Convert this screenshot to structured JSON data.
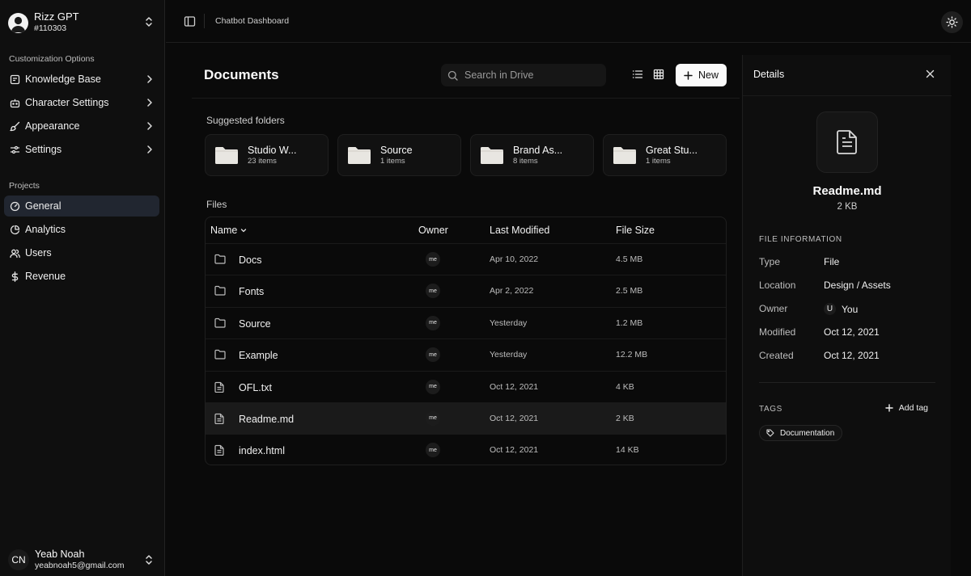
{
  "team": {
    "name": "Rizz GPT",
    "id": "#110303"
  },
  "sidebar": {
    "section_customization": "Customization Options",
    "customization_items": [
      {
        "label": "Knowledge Base",
        "icon": "book-icon"
      },
      {
        "label": "Character Settings",
        "icon": "bot-icon"
      },
      {
        "label": "Appearance",
        "icon": "brush-icon"
      },
      {
        "label": "Settings",
        "icon": "sliders-icon"
      }
    ],
    "section_projects": "Projects",
    "project_items": [
      {
        "label": "General",
        "icon": "gauge-icon",
        "active": true
      },
      {
        "label": "Analytics",
        "icon": "pie-chart-icon"
      },
      {
        "label": "Users",
        "icon": "users-icon"
      },
      {
        "label": "Revenue",
        "icon": "dollar-icon"
      }
    ]
  },
  "user": {
    "initials": "CN",
    "name": "Yeab Noah",
    "email": "yeabnoah5@gmail.com"
  },
  "header": {
    "breadcrumb": "Chatbot Dashboard"
  },
  "documents": {
    "title": "Documents",
    "search_placeholder": "Search in Drive",
    "new_label": "New",
    "suggested_label": "Suggested folders",
    "folders": [
      {
        "name": "Studio W...",
        "count": "23 items"
      },
      {
        "name": "Source",
        "count": "1 items"
      },
      {
        "name": "Brand As...",
        "count": "8 items"
      },
      {
        "name": "Great Stu...",
        "count": "1 items"
      }
    ],
    "files_label": "Files",
    "columns": {
      "name": "Name",
      "owner": "Owner",
      "modified": "Last Modified",
      "size": "File Size"
    },
    "files": [
      {
        "name": "Docs",
        "type": "folder",
        "owner": "me",
        "modified": "Apr 10, 2022",
        "size": "4.5 MB"
      },
      {
        "name": "Fonts",
        "type": "folder",
        "owner": "me",
        "modified": "Apr 2, 2022",
        "size": "2.5 MB"
      },
      {
        "name": "Source",
        "type": "folder",
        "owner": "me",
        "modified": "Yesterday",
        "size": "1.2 MB"
      },
      {
        "name": "Example",
        "type": "folder",
        "owner": "me",
        "modified": "Yesterday",
        "size": "12.2 MB"
      },
      {
        "name": "OFL.txt",
        "type": "file",
        "owner": "me",
        "modified": "Oct 12, 2021",
        "size": "4 KB"
      },
      {
        "name": "Readme.md",
        "type": "file",
        "owner": "me",
        "modified": "Oct 12, 2021",
        "size": "2 KB",
        "selected": true
      },
      {
        "name": "index.html",
        "type": "file",
        "owner": "me",
        "modified": "Oct 12, 2021",
        "size": "14 KB"
      }
    ]
  },
  "details": {
    "title": "Details",
    "file_name": "Readme.md",
    "file_size": "2 KB",
    "info_label": "FILE INFORMATION",
    "info": {
      "type_key": "Type",
      "type_val": "File",
      "location_key": "Location",
      "location_val": "Design / Assets",
      "owner_key": "Owner",
      "owner_initial": "U",
      "owner_val": "You",
      "modified_key": "Modified",
      "modified_val": "Oct 12, 2021",
      "created_key": "Created",
      "created_val": "Oct 12, 2021"
    },
    "tags_label": "TAGS",
    "add_tag_label": "Add tag",
    "tags": [
      "Documentation"
    ]
  }
}
